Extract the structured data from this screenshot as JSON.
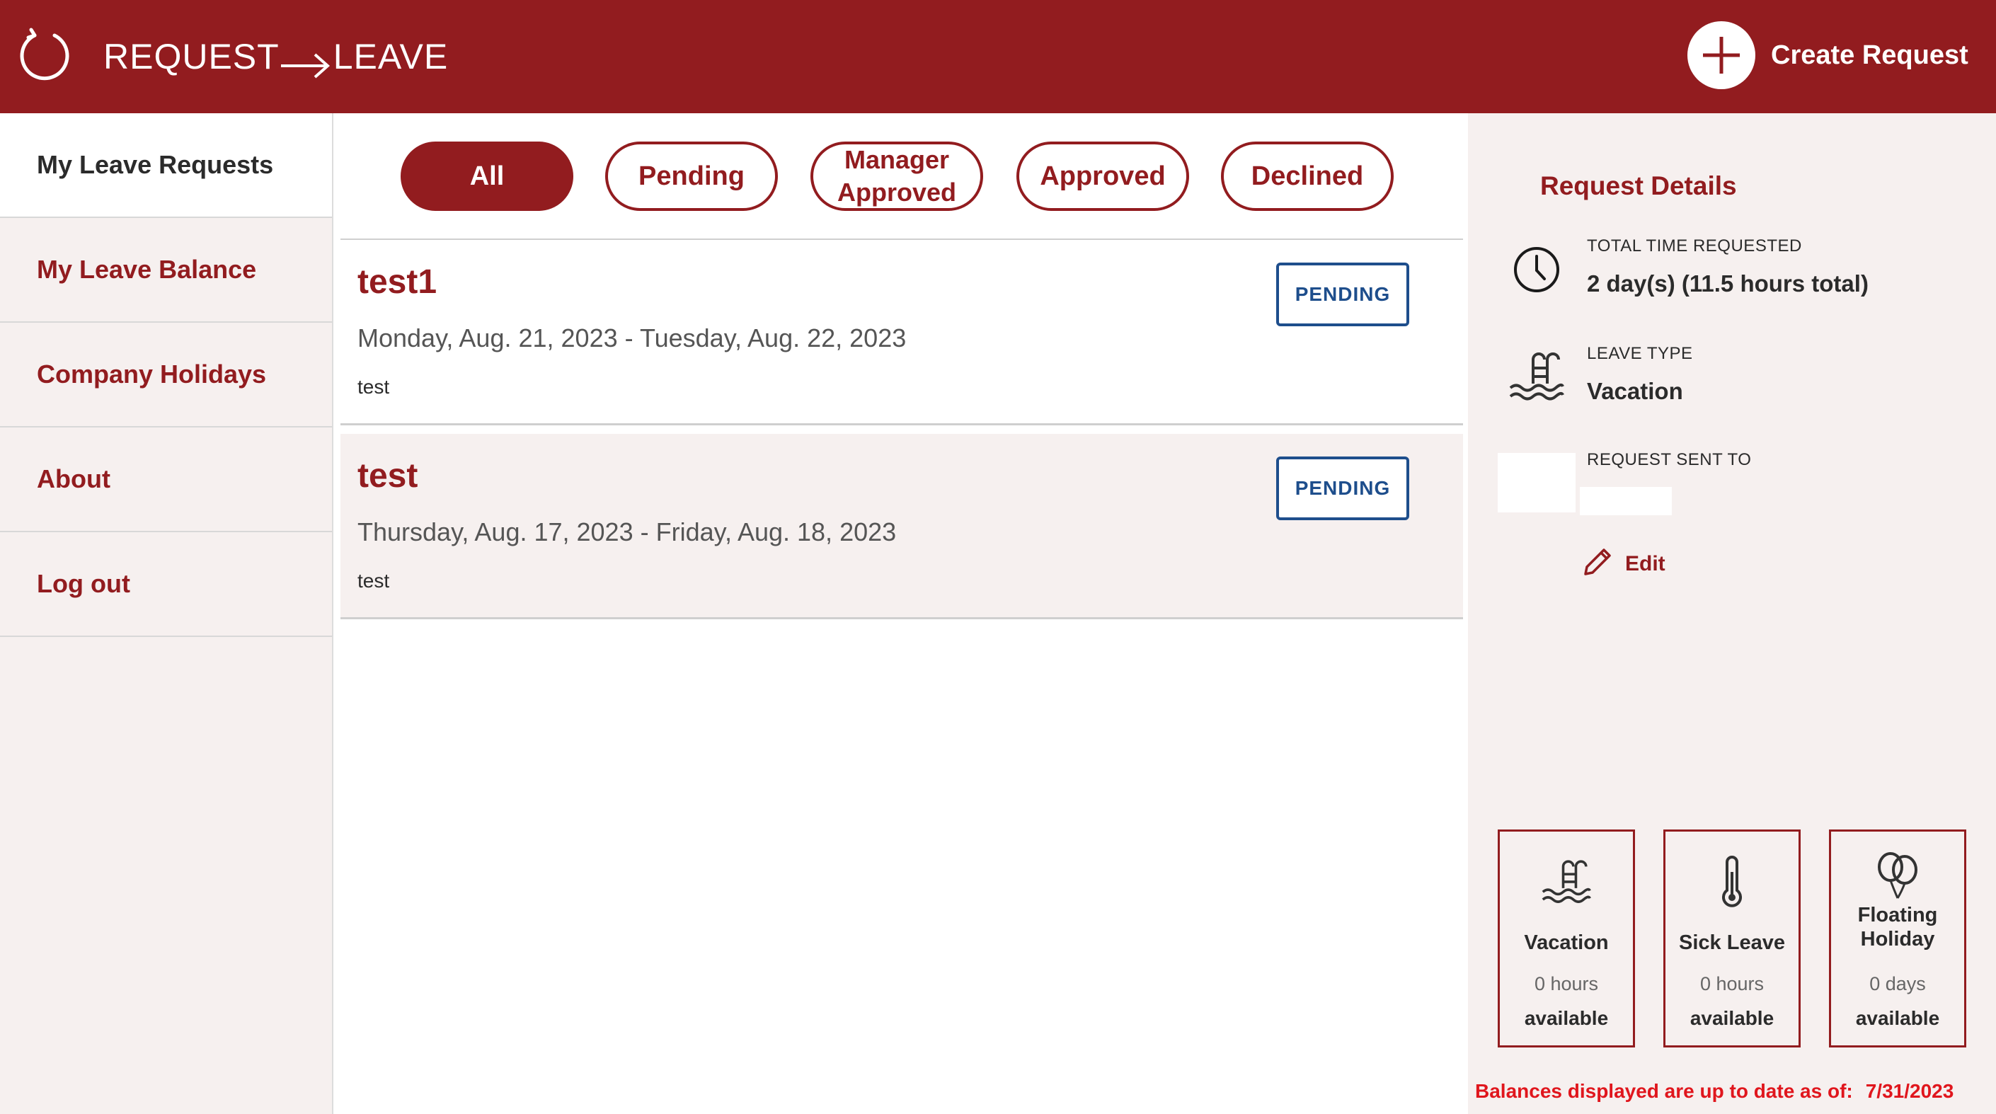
{
  "header": {
    "title_left": "REQUEST",
    "title_right": "LEAVE",
    "create_label": "Create Request"
  },
  "icons": {
    "refresh": "refresh-icon",
    "arrow": "arrow-right-icon",
    "plus": "plus-icon",
    "clock": "clock-icon",
    "pool": "pool-ladder-icon",
    "pencil": "pencil-icon",
    "thermometer": "thermometer-icon",
    "balloons": "balloons-icon"
  },
  "colors": {
    "brand": "#921c1f",
    "status_blue": "#1e4e8c",
    "panel_bg": "#f6f0ef",
    "alert_red": "#e0161d"
  },
  "sidebar": {
    "items": [
      {
        "label": "My Leave Requests",
        "active": true
      },
      {
        "label": "My Leave Balance"
      },
      {
        "label": "Company Holidays"
      },
      {
        "label": "About"
      },
      {
        "label": "Log out"
      }
    ]
  },
  "filters": [
    {
      "label": "All",
      "active": true
    },
    {
      "label": "Pending"
    },
    {
      "label": "Manager Approved"
    },
    {
      "label": "Approved"
    },
    {
      "label": "Declined"
    }
  ],
  "requests": [
    {
      "title": "test1",
      "dates": "Monday, Aug. 21, 2023 - Tuesday, Aug. 22, 2023",
      "note": "test",
      "status": "PENDING"
    },
    {
      "title": "test",
      "dates": "Thursday, Aug. 17, 2023 - Friday, Aug. 18, 2023",
      "note": "test",
      "status": "PENDING"
    }
  ],
  "details": {
    "title": "Request Details",
    "total_time_label": "TOTAL TIME REQUESTED",
    "total_time_value": "2 day(s) (11.5 hours total)",
    "leave_type_label": "LEAVE TYPE",
    "leave_type_value": "Vacation",
    "sent_to_label": "REQUEST SENT TO",
    "edit_label": "Edit"
  },
  "balances": [
    {
      "name": "Vacation",
      "amount": "0 hours",
      "avail": "available",
      "icon": "pool-ladder-icon"
    },
    {
      "name": "Sick Leave",
      "amount": "0 hours",
      "avail": "available",
      "icon": "thermometer-icon"
    },
    {
      "name": "Floating Holiday",
      "amount": "0 days",
      "avail": "available",
      "icon": "balloons-icon"
    }
  ],
  "balance_footer": {
    "text": "Balances displayed are up to date as of:",
    "date": "7/31/2023"
  }
}
